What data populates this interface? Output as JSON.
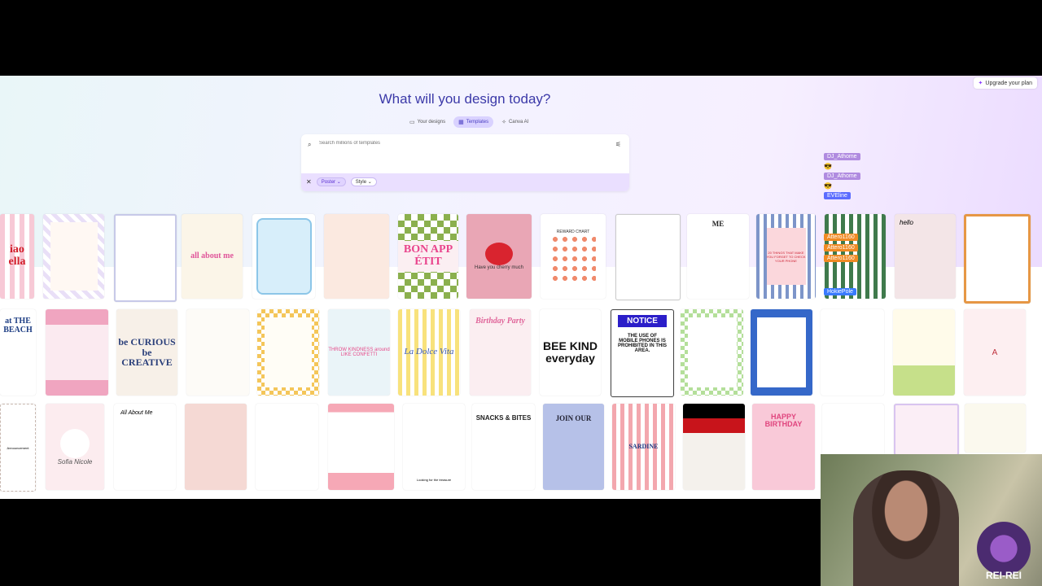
{
  "header": {
    "upgrade_label": "Upgrade your plan",
    "headline": "What will you design today?"
  },
  "tabs": [
    {
      "label": "Your designs",
      "icon": "folder-icon"
    },
    {
      "label": "Templates",
      "icon": "template-icon",
      "active": true
    },
    {
      "label": "Canva AI",
      "icon": "sparkle-icon"
    }
  ],
  "search": {
    "placeholder": "Search millions of templates",
    "filters": {
      "poster": "Poster",
      "style": "Style"
    }
  },
  "cards": {
    "row1": [
      "iao ella",
      "",
      "",
      "all about me",
      "",
      "",
      "BON APP ÉTIT",
      "Have you cherry much",
      "REWARD CHART",
      "",
      "ME",
      "20 THINGS THAT MAKE YOU FORGET TO CHECK YOUR PHONE",
      "",
      "hello",
      ""
    ],
    "row2": [
      "at THE BEACH",
      "",
      "be CURIOUS be CREATIVE",
      "",
      "",
      "THROW KINDNESS around LIKE CONFETTI",
      "La Dolce Vita",
      "Birthday Party",
      "BEE KIND everyday",
      "NOTICE",
      "THE USE OF MOBILE PHONES IS PROHIBITED IN THIS AREA.",
      "",
      "",
      "",
      "",
      "A"
    ],
    "row3": [
      "Announcement",
      "Sofia Nicole",
      "All About Me",
      "",
      "",
      "",
      "Looking for the treasure",
      "SNACKS & BITES",
      "JOIN OUR",
      "SARDINE",
      "",
      "HAPPY BIRTHDAY",
      ""
    ]
  },
  "chat": [
    {
      "user": "DJ_Athome",
      "color": "#b08be0"
    },
    {
      "user": "DJ_Athome",
      "color": "#b08be0"
    },
    {
      "user": "EVEline",
      "color": "#5b6cff"
    },
    {
      "user": "Attero1160",
      "color": "#f08a24"
    },
    {
      "user": "Attero1160",
      "color": "#f08a24"
    },
    {
      "user": "Attero1160",
      "color": "#f08a24"
    },
    {
      "user": "HokiePole",
      "color": "#3a7bff"
    }
  ],
  "stream": {
    "logo_text": "REI-REI"
  }
}
